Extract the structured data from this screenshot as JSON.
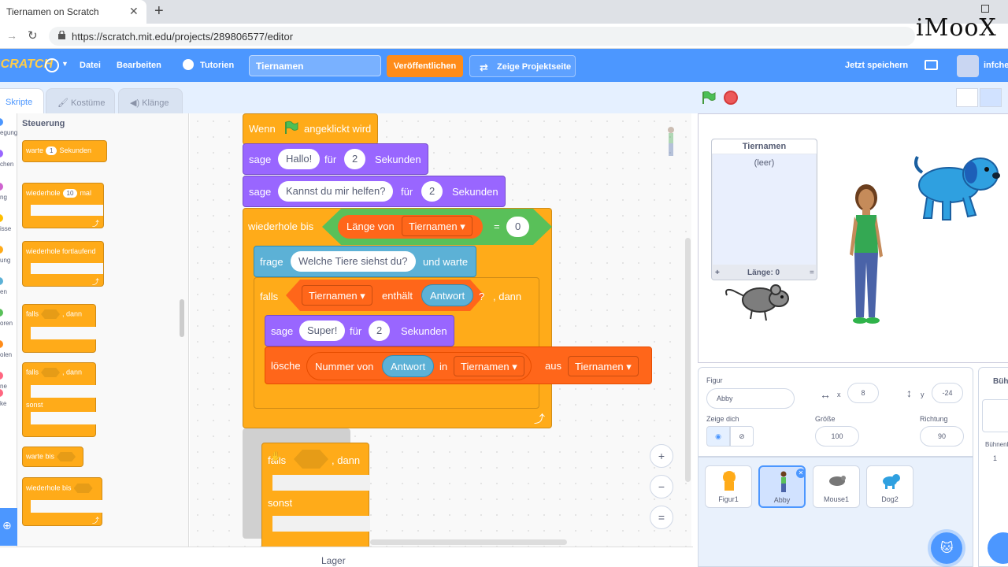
{
  "browser": {
    "tab_title": "Tiernamen on Scratch",
    "url": "https://scratch.mit.edu/projects/289806577/editor",
    "watermark": "iMooX"
  },
  "menubar": {
    "logo": "SCRATCH",
    "file": "Datei",
    "edit": "Bearbeiten",
    "tutorials": "Tutorien",
    "project_title": "Tiernamen",
    "publish": "Veröffentlichen",
    "show_project_page": "Zeige Projektseite",
    "save_now": "Jetzt speichern",
    "username": "infche"
  },
  "tabs": {
    "scripts": "Skripte",
    "costumes": "Kostüme",
    "sounds": "Klänge"
  },
  "categories": [
    {
      "label": "egung",
      "color": "#4c97ff"
    },
    {
      "label": "chen",
      "color": "#9966ff"
    },
    {
      "label": "ng",
      "color": "#cf63cf"
    },
    {
      "label": "isse",
      "color": "#ffbf00"
    },
    {
      "label": "ung",
      "color": "#ffab19"
    },
    {
      "label": "en",
      "color": "#5cb1d6"
    },
    {
      "label": "oren",
      "color": "#59c059"
    },
    {
      "label": "olen",
      "color": "#ff8c1a"
    },
    {
      "label": "ne",
      "color": "#ff6680"
    },
    {
      "label": "ke",
      "color": "#ff6680"
    }
  ],
  "palette": {
    "title": "Steuerung",
    "wait_a": "warte",
    "wait_num": "1",
    "wait_b": "Sekunden",
    "repeat_a": "wiederhole",
    "repeat_num": "10",
    "repeat_b": "mal",
    "forever": "wiederhole fortlaufend",
    "if": "falls",
    "then": ", dann",
    "if2": "falls",
    "then2": ", dann",
    "else": "sonst",
    "wait_until": "warte bis",
    "repeat_until": "wiederhole bis"
  },
  "script": {
    "hat_a": "Wenn",
    "hat_b": "angeklickt wird",
    "say1_a": "sage",
    "say1_msg": "Hallo!",
    "say1_b": "für",
    "say1_secs": "2",
    "say1_c": "Sekunden",
    "say2_a": "sage",
    "say2_msg": "Kannst du mir helfen?",
    "say2_b": "für",
    "say2_secs": "2",
    "say2_c": "Sekunden",
    "until": "wiederhole bis",
    "length_of": "Länge von",
    "list1": "Tiernamen",
    "equals": "=",
    "zero": "0",
    "ask_a": "frage",
    "ask_msg": "Welche Tiere siehst du?",
    "ask_b": "und warte",
    "if_a": "falls",
    "list2": "Tiernamen",
    "contains": "enthält",
    "answer1": "Antwort",
    "q": "?",
    "if_b": ", dann",
    "say3_a": "sage",
    "say3_msg": "Super!",
    "say3_b": "für",
    "say3_secs": "2",
    "say3_c": "Sekunden",
    "del_a": "lösche",
    "item_of": "Nummer von",
    "answer2": "Antwort",
    "in": "in",
    "list3": "Tiernamen",
    "from": "aus",
    "list4": "Tiernamen"
  },
  "dragged": {
    "if": "falls",
    "then": ", dann",
    "else": "sonst"
  },
  "zoom": {
    "in": "+",
    "out": "−",
    "reset": "="
  },
  "bottom": {
    "backpack": "Lager"
  },
  "stage": {
    "list_title": "Tiernamen",
    "list_empty": "(leer)",
    "list_add": "+",
    "list_length": "Länge: 0",
    "list_resize": "="
  },
  "sprite_info": {
    "sprite_label": "Figur",
    "sprite_name": "Abby",
    "x_label": "x",
    "x": "8",
    "y_label": "y",
    "y": "-24",
    "show_label": "Zeige dich",
    "size_label": "Größe",
    "size": "100",
    "direction_label": "Richtung",
    "direction": "90"
  },
  "sprites": [
    {
      "name": "Figur1",
      "color": "#ffab19"
    },
    {
      "name": "Abby",
      "color": "#59c059"
    },
    {
      "name": "Mouse1",
      "color": "#777777"
    },
    {
      "name": "Dog2",
      "color": "#2fa0e0"
    }
  ],
  "stage_pane": {
    "label": "Bühne",
    "sub": "Bühnenb",
    "count": "1"
  },
  "colors": {
    "control": "#ffab19",
    "looks": "#9966ff",
    "sensing": "#5cb1d6",
    "operators": "#59c059",
    "list": "#ff661a",
    "brand": "#4c97ff"
  }
}
